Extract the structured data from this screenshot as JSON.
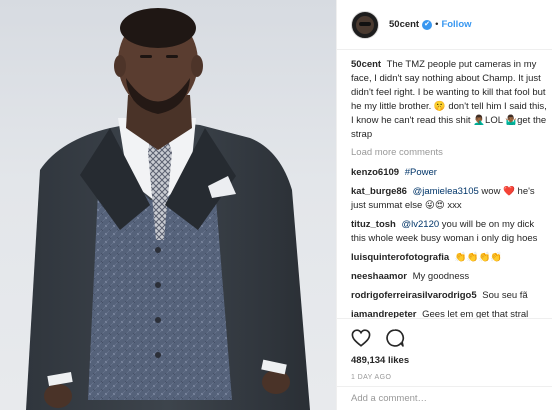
{
  "header": {
    "username": "50cent",
    "verified_mark": "✔",
    "separator": "•",
    "follow_label": "Follow"
  },
  "caption": {
    "username": "50cent",
    "text": "The TMZ people put cameras in my face, I didn't say nothing about Champ. It just didn't feel right. I be wanting to kill that fool but he my little brother. 🤫 don't tell him I said this, I know he can't read this shit 🤦🏾‍♂️LOL 🤷🏾‍♂️get the strap"
  },
  "load_more_label": "Load more comments",
  "comments": [
    {
      "username": "kenzo6109",
      "mention": "",
      "text": "",
      "hashtag": "#Power"
    },
    {
      "username": "kat_burge86",
      "mention": "@jamielea3105",
      "text": " wow ❤️ he's just summat else 😜😍 xxx",
      "hashtag": ""
    },
    {
      "username": "tituz_tosh",
      "mention": "@lv2120",
      "text": " you will be on my dick this whole week busy woman i only dig hoes",
      "hashtag": ""
    },
    {
      "username": "luisquinterofotografia",
      "mention": "",
      "text": "👏👏👏👏",
      "hashtag": ""
    },
    {
      "username": "neeshaamor",
      "mention": "",
      "text": "My goodness",
      "hashtag": ""
    },
    {
      "username": "rodrigoferreirasilvarodrigo5",
      "mention": "",
      "text": "Sou seu fã",
      "hashtag": ""
    },
    {
      "username": "iamandrepeter",
      "mention": "",
      "text": "Gees let em get that stral",
      "hashtag": ""
    }
  ],
  "icons": {
    "like": "heart-icon",
    "comment": "comment-bubble-icon"
  },
  "likes_label": "489,134 likes",
  "time_label": "1 DAY AGO",
  "add_comment_placeholder": "Add a comment…",
  "colors": {
    "accent": "#3897f0",
    "link": "#003569",
    "muted": "#999999",
    "text": "#262626"
  }
}
